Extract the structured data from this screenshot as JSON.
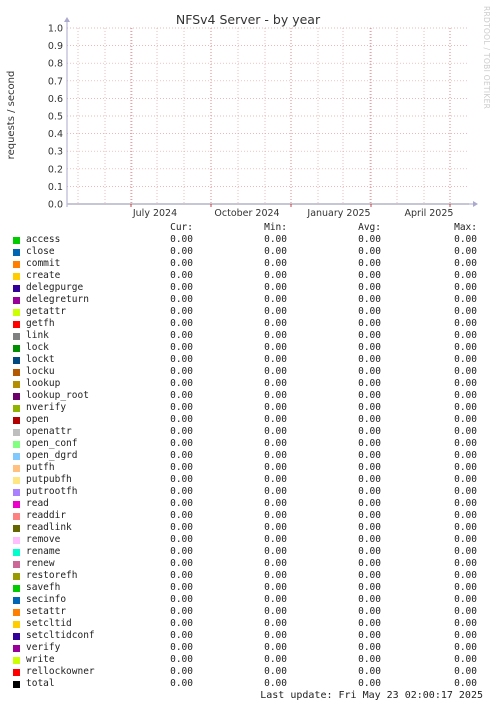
{
  "chart_data": {
    "type": "line",
    "title": "NFSv4 Server - by year",
    "ylabel": "requests / second",
    "xlabel": "",
    "ylim": [
      0,
      1.0
    ],
    "yticks": [
      "0.0",
      "0.1",
      "0.2",
      "0.3",
      "0.4",
      "0.5",
      "0.6",
      "0.7",
      "0.8",
      "0.9",
      "1.0"
    ],
    "xticks": [
      "July 2024",
      "October 2024",
      "January 2025",
      "April 2025"
    ],
    "watermark": "RRDTOOL / TOBI OETIKER",
    "grid": true,
    "series_all_zero": true
  },
  "legend": {
    "headers": {
      "cur": "Cur:",
      "min": "Min:",
      "avg": "Avg:",
      "max": "Max:"
    },
    "rows": [
      {
        "name": "access",
        "color": "#00cc00",
        "cur": "0.00",
        "min": "0.00",
        "avg": "0.00",
        "max": "0.00"
      },
      {
        "name": "close",
        "color": "#0066b3",
        "cur": "0.00",
        "min": "0.00",
        "avg": "0.00",
        "max": "0.00"
      },
      {
        "name": "commit",
        "color": "#ff8000",
        "cur": "0.00",
        "min": "0.00",
        "avg": "0.00",
        "max": "0.00"
      },
      {
        "name": "create",
        "color": "#ffcc00",
        "cur": "0.00",
        "min": "0.00",
        "avg": "0.00",
        "max": "0.00"
      },
      {
        "name": "delegpurge",
        "color": "#330099",
        "cur": "0.00",
        "min": "0.00",
        "avg": "0.00",
        "max": "0.00"
      },
      {
        "name": "delegreturn",
        "color": "#990099",
        "cur": "0.00",
        "min": "0.00",
        "avg": "0.00",
        "max": "0.00"
      },
      {
        "name": "getattr",
        "color": "#ccff00",
        "cur": "0.00",
        "min": "0.00",
        "avg": "0.00",
        "max": "0.00"
      },
      {
        "name": "getfh",
        "color": "#ff0000",
        "cur": "0.00",
        "min": "0.00",
        "avg": "0.00",
        "max": "0.00"
      },
      {
        "name": "link",
        "color": "#808080",
        "cur": "0.00",
        "min": "0.00",
        "avg": "0.00",
        "max": "0.00"
      },
      {
        "name": "lock",
        "color": "#008f00",
        "cur": "0.00",
        "min": "0.00",
        "avg": "0.00",
        "max": "0.00"
      },
      {
        "name": "lockt",
        "color": "#00487d",
        "cur": "0.00",
        "min": "0.00",
        "avg": "0.00",
        "max": "0.00"
      },
      {
        "name": "locku",
        "color": "#b35a00",
        "cur": "0.00",
        "min": "0.00",
        "avg": "0.00",
        "max": "0.00"
      },
      {
        "name": "lookup",
        "color": "#b38f00",
        "cur": "0.00",
        "min": "0.00",
        "avg": "0.00",
        "max": "0.00"
      },
      {
        "name": "lookup_root",
        "color": "#6b006b",
        "cur": "0.00",
        "min": "0.00",
        "avg": "0.00",
        "max": "0.00"
      },
      {
        "name": "nverify",
        "color": "#8fb300",
        "cur": "0.00",
        "min": "0.00",
        "avg": "0.00",
        "max": "0.00"
      },
      {
        "name": "open",
        "color": "#b30000",
        "cur": "0.00",
        "min": "0.00",
        "avg": "0.00",
        "max": "0.00"
      },
      {
        "name": "openattr",
        "color": "#bebebe",
        "cur": "0.00",
        "min": "0.00",
        "avg": "0.00",
        "max": "0.00"
      },
      {
        "name": "open_conf",
        "color": "#80ff80",
        "cur": "0.00",
        "min": "0.00",
        "avg": "0.00",
        "max": "0.00"
      },
      {
        "name": "open_dgrd",
        "color": "#80c9ff",
        "cur": "0.00",
        "min": "0.00",
        "avg": "0.00",
        "max": "0.00"
      },
      {
        "name": "putfh",
        "color": "#ffc080",
        "cur": "0.00",
        "min": "0.00",
        "avg": "0.00",
        "max": "0.00"
      },
      {
        "name": "putpubfh",
        "color": "#ffe680",
        "cur": "0.00",
        "min": "0.00",
        "avg": "0.00",
        "max": "0.00"
      },
      {
        "name": "putrootfh",
        "color": "#aa80ff",
        "cur": "0.00",
        "min": "0.00",
        "avg": "0.00",
        "max": "0.00"
      },
      {
        "name": "read",
        "color": "#ee00cc",
        "cur": "0.00",
        "min": "0.00",
        "avg": "0.00",
        "max": "0.00"
      },
      {
        "name": "readdir",
        "color": "#ff8080",
        "cur": "0.00",
        "min": "0.00",
        "avg": "0.00",
        "max": "0.00"
      },
      {
        "name": "readlink",
        "color": "#666600",
        "cur": "0.00",
        "min": "0.00",
        "avg": "0.00",
        "max": "0.00"
      },
      {
        "name": "remove",
        "color": "#ffbfff",
        "cur": "0.00",
        "min": "0.00",
        "avg": "0.00",
        "max": "0.00"
      },
      {
        "name": "rename",
        "color": "#00ffcc",
        "cur": "0.00",
        "min": "0.00",
        "avg": "0.00",
        "max": "0.00"
      },
      {
        "name": "renew",
        "color": "#cc6699",
        "cur": "0.00",
        "min": "0.00",
        "avg": "0.00",
        "max": "0.00"
      },
      {
        "name": "restorefh",
        "color": "#999900",
        "cur": "0.00",
        "min": "0.00",
        "avg": "0.00",
        "max": "0.00"
      },
      {
        "name": "savefh",
        "color": "#00cc00",
        "cur": "0.00",
        "min": "0.00",
        "avg": "0.00",
        "max": "0.00"
      },
      {
        "name": "secinfo",
        "color": "#0066b3",
        "cur": "0.00",
        "min": "0.00",
        "avg": "0.00",
        "max": "0.00"
      },
      {
        "name": "setattr",
        "color": "#ff8000",
        "cur": "0.00",
        "min": "0.00",
        "avg": "0.00",
        "max": "0.00"
      },
      {
        "name": "setcltid",
        "color": "#ffcc00",
        "cur": "0.00",
        "min": "0.00",
        "avg": "0.00",
        "max": "0.00"
      },
      {
        "name": "setcltidconf",
        "color": "#330099",
        "cur": "0.00",
        "min": "0.00",
        "avg": "0.00",
        "max": "0.00"
      },
      {
        "name": "verify",
        "color": "#990099",
        "cur": "0.00",
        "min": "0.00",
        "avg": "0.00",
        "max": "0.00"
      },
      {
        "name": "write",
        "color": "#ccff00",
        "cur": "0.00",
        "min": "0.00",
        "avg": "0.00",
        "max": "0.00"
      },
      {
        "name": "rellockowner",
        "color": "#ff0000",
        "cur": "0.00",
        "min": "0.00",
        "avg": "0.00",
        "max": "0.00"
      },
      {
        "name": "total",
        "color": "#000000",
        "cur": "0.00",
        "min": "0.00",
        "avg": "0.00",
        "max": "0.00"
      }
    ]
  },
  "last_update": "Last update: Fri May 23 02:00:17 2025"
}
